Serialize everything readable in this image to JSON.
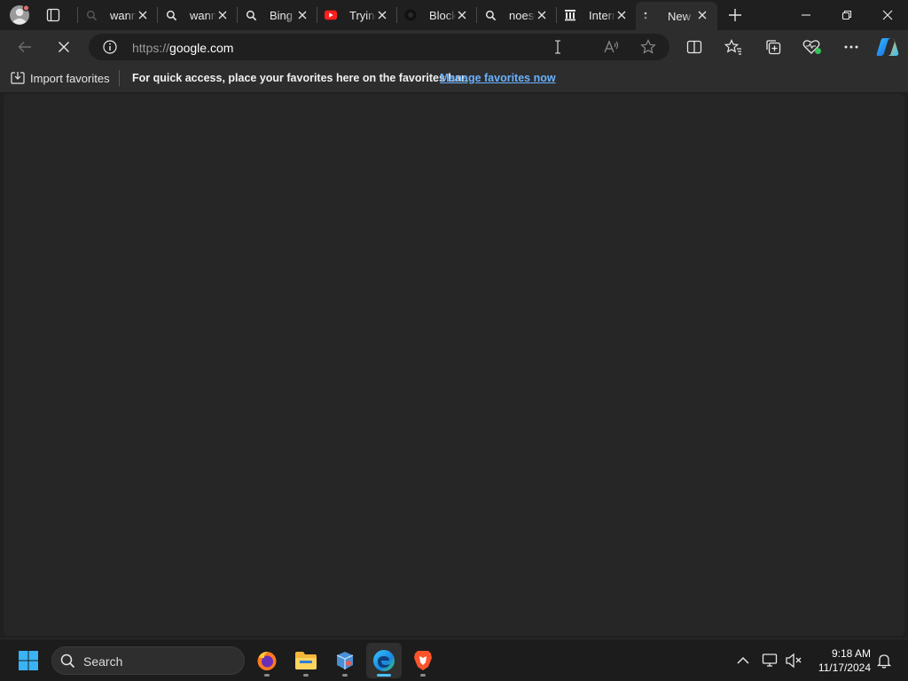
{
  "tabs": [
    {
      "title": "wann",
      "favicon": "search-icon",
      "active": false
    },
    {
      "title": "wann",
      "favicon": "search-icon",
      "active": false
    },
    {
      "title": "Bing",
      "favicon": "search-icon",
      "active": false
    },
    {
      "title": "Trying",
      "favicon": "youtube-icon",
      "active": false
    },
    {
      "title": "Block",
      "favicon": "github-icon",
      "active": false
    },
    {
      "title": "noesc",
      "favicon": "search-icon",
      "active": false
    },
    {
      "title": "Intern",
      "favicon": "archive-icon",
      "active": false
    },
    {
      "title": "New t",
      "favicon": "loading-icon",
      "active": true
    }
  ],
  "address": {
    "scheme": "https://",
    "host": "google.com"
  },
  "favorites_bar": {
    "import_label": "Import favorites",
    "message": "For quick access, place your favorites here on the favorites bar.",
    "manage_link": "Manage favorites now"
  },
  "taskbar": {
    "search_label": "Search",
    "time": "9:18 AM",
    "date": "11/17/2024",
    "apps": [
      "firefox-icon",
      "file-explorer-icon",
      "app-icon",
      "edge-icon",
      "brave-icon"
    ]
  },
  "colors": {
    "accent": "#4cc2ff",
    "link": "#6ab2ff",
    "content_bg": "#262626"
  }
}
